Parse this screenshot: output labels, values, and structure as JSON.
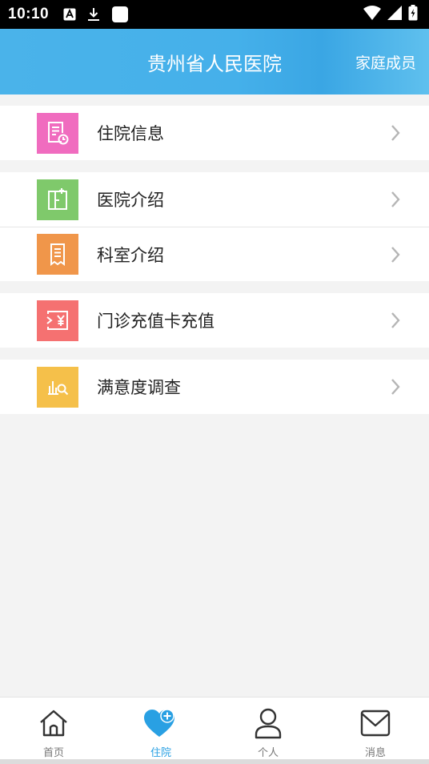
{
  "status_bar": {
    "time": "10:10"
  },
  "header": {
    "title": "贵州省人民医院",
    "action": "家庭成员"
  },
  "colors": {
    "header_blue": "#45b0ea",
    "inpatient_pink": "#f06cbf",
    "intro_green": "#7fc96b",
    "dept_orange": "#f0964a",
    "recharge_red": "#f57171",
    "survey_yellow": "#f5c04a",
    "active_tab": "#29a0e3"
  },
  "menu": {
    "groups": [
      {
        "items": [
          {
            "label": "住院信息",
            "icon": "document-clock-icon"
          }
        ]
      },
      {
        "items": [
          {
            "label": "医院介绍",
            "icon": "building-icon"
          },
          {
            "label": "科室介绍",
            "icon": "receipt-icon"
          }
        ]
      },
      {
        "items": [
          {
            "label": "门诊充值卡充值",
            "icon": "card-yuan-icon"
          }
        ]
      },
      {
        "items": [
          {
            "label": "满意度调查",
            "icon": "chart-search-icon"
          }
        ]
      }
    ]
  },
  "nav": {
    "items": [
      {
        "label": "首页",
        "icon": "home-icon"
      },
      {
        "label": "住院",
        "icon": "heart-plus-icon",
        "active": true
      },
      {
        "label": "个人",
        "icon": "person-icon"
      },
      {
        "label": "消息",
        "icon": "mail-icon"
      }
    ]
  }
}
